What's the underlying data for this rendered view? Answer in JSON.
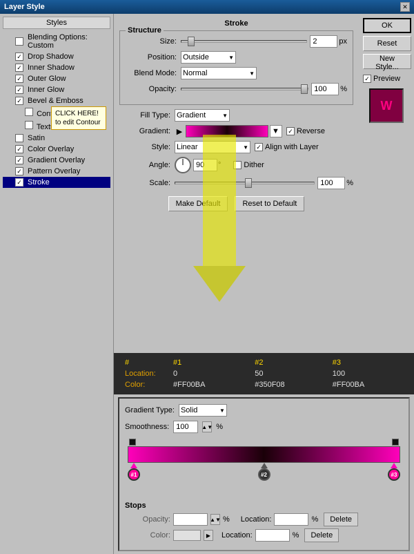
{
  "window": {
    "title": "Layer Style",
    "close_label": "✕"
  },
  "left_panel": {
    "header": "Styles",
    "items": [
      {
        "id": "blending",
        "label": "Blending Options: Custom",
        "checked": false,
        "active": false
      },
      {
        "id": "drop-shadow",
        "label": "Drop Shadow",
        "checked": true,
        "active": false
      },
      {
        "id": "inner-shadow",
        "label": "Inner Shadow",
        "checked": true,
        "active": false
      },
      {
        "id": "outer-glow",
        "label": "Outer Glow",
        "checked": true,
        "active": false
      },
      {
        "id": "inner-glow",
        "label": "Inner Glow",
        "checked": true,
        "active": false
      },
      {
        "id": "bevel",
        "label": "Bevel & Emboss",
        "checked": true,
        "active": false
      },
      {
        "id": "contour",
        "label": "Contour",
        "checked": false,
        "sub": true,
        "active": false
      },
      {
        "id": "texture",
        "label": "Texture",
        "checked": false,
        "sub": true,
        "active": false
      },
      {
        "id": "satin",
        "label": "Satin",
        "checked": false,
        "active": false
      },
      {
        "id": "color-overlay",
        "label": "Color Overlay",
        "checked": true,
        "active": false
      },
      {
        "id": "gradient-overlay",
        "label": "Gradient Overlay",
        "checked": true,
        "active": false
      },
      {
        "id": "pattern-overlay",
        "label": "Pattern Overlay",
        "checked": true,
        "active": false
      },
      {
        "id": "stroke",
        "label": "Stroke",
        "checked": true,
        "active": true
      }
    ]
  },
  "stroke": {
    "section_title": "Stroke",
    "structure_label": "Structure",
    "size_label": "Size:",
    "size_value": "2",
    "size_unit": "px",
    "position_label": "Position:",
    "position_value": "Outside",
    "blend_mode_label": "Blend Mode:",
    "blend_mode_value": "Normal",
    "opacity_label": "Opacity:",
    "opacity_value": "100",
    "opacity_unit": "%",
    "fill_type_label": "Fill Type:",
    "fill_type_value": "Gradient",
    "gradient_label": "Gradient:",
    "reverse_label": "Reverse",
    "reverse_checked": true,
    "style_label": "Style:",
    "style_value": "Linear",
    "align_label": "Align with Layer",
    "align_checked": true,
    "angle_label": "Angle:",
    "angle_value": "90",
    "angle_unit": "°",
    "dither_label": "Dither",
    "dither_checked": false,
    "scale_label": "Scale:",
    "scale_value": "100",
    "scale_unit": "%",
    "make_default": "Make Default",
    "reset_default": "Reset to Default"
  },
  "right_buttons": {
    "ok": "OK",
    "reset": "Reset",
    "new_style": "New Style...",
    "preview_label": "Preview",
    "preview_checked": true
  },
  "tooltip": {
    "text": "CLICK HERE! to edit Contour"
  },
  "gradient_table": {
    "headers": [
      "#",
      "#1",
      "#2",
      "#3"
    ],
    "location_label": "Location:",
    "location_values": [
      "0",
      "50",
      "100"
    ],
    "color_label": "Color:",
    "color_values": [
      "#FF00BA",
      "#350F08",
      "#FF00BA"
    ]
  },
  "gradient_editor": {
    "type_label": "Gradient Type:",
    "type_value": "Solid",
    "smoothness_label": "Smoothness:",
    "smoothness_value": "100",
    "smoothness_unit": "%",
    "stops": [
      {
        "id": "#1",
        "color": "#FF00BA",
        "position": "left"
      },
      {
        "id": "#2",
        "color": "#333333",
        "position": "center"
      },
      {
        "id": "#3",
        "color": "#FF00BA",
        "position": "right"
      }
    ],
    "stops_label": "Stops",
    "opacity_label": "Opacity:",
    "opacity_unit": "%",
    "location_label": "Location:",
    "location_unit": "%",
    "delete_label": "Delete",
    "color_label": "Color:",
    "color_location_label": "Location:",
    "color_location_unit": "%",
    "color_delete_label": "Delete"
  }
}
